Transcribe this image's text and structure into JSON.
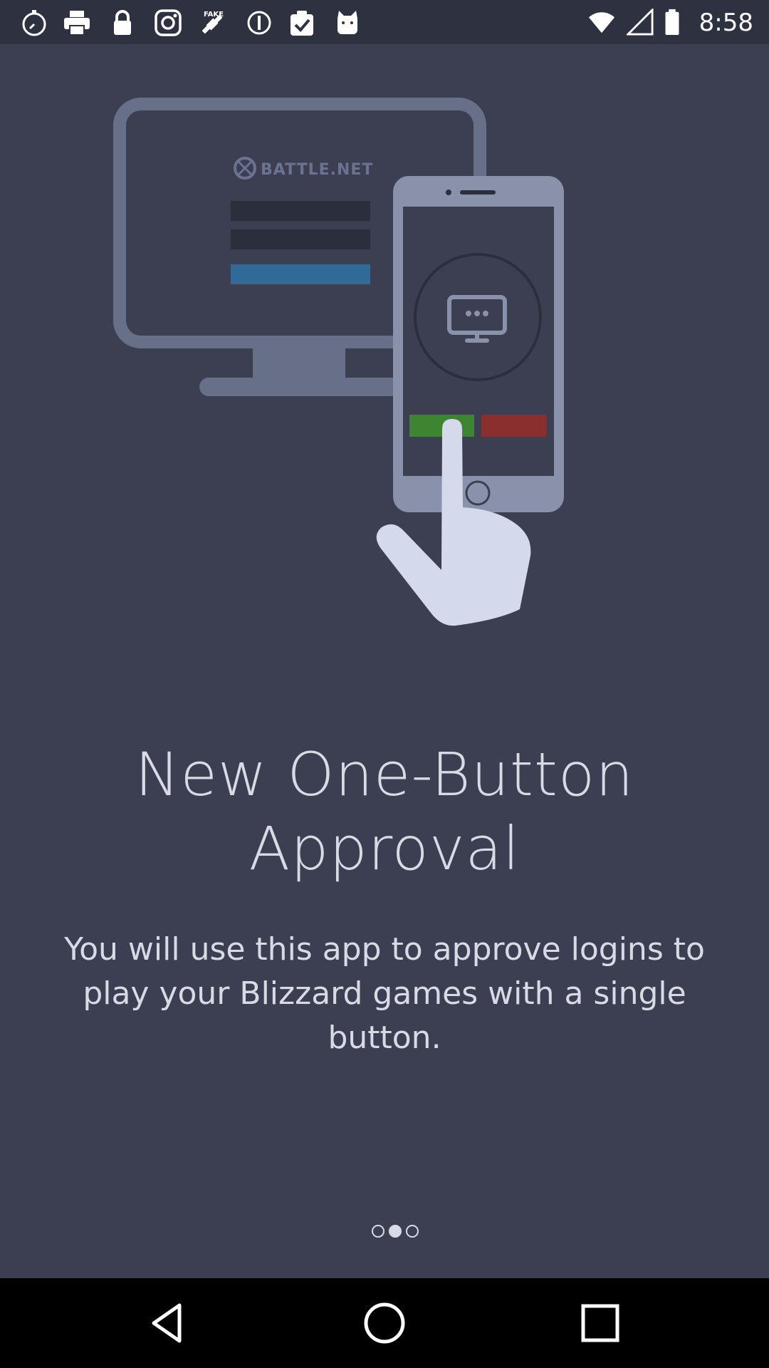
{
  "status_bar": {
    "time": "8:58",
    "left_icons": [
      "stopwatch-icon",
      "printer-icon",
      "lock-icon",
      "instagram-icon",
      "fake-gps-icon",
      "alert-circle-icon",
      "clipboard-check-icon",
      "cat-icon"
    ],
    "right_icons": [
      "wifi-icon",
      "signal-icon",
      "battery-icon"
    ]
  },
  "illustration": {
    "brand_text": "BATTLE.NET",
    "colors": {
      "monitor_frame": "#687089",
      "phone_frame": "#8a91ab",
      "screen_bg": "#3b3f51",
      "input_fields": "#2a2e3d",
      "login_bar": "#2f6a99",
      "approve_button": "#3e8532",
      "deny_button": "#8a2e2e",
      "hand": "#d5d9ec"
    }
  },
  "onboarding": {
    "title_line1": "New One-Button",
    "title_line2": "Approval",
    "description": "You will use this app to approve logins to play your Blizzard games with a single button.",
    "page_count": 3,
    "current_page": 2
  },
  "nav_bar": {
    "buttons": [
      "back-icon",
      "home-icon",
      "recents-icon"
    ]
  }
}
